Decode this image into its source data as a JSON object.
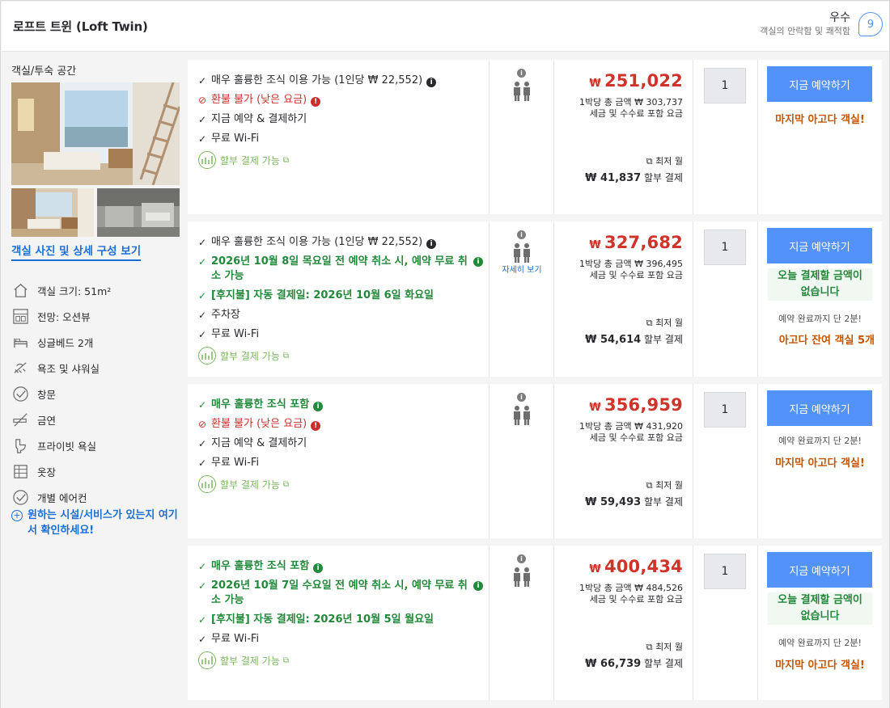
{
  "header": {
    "room_title": "로프트 트윈 (Loft Twin)",
    "score_label": "우수",
    "score_sub": "객실의 안락함 및 쾌적함",
    "score_value": "9"
  },
  "sidebar": {
    "section_title": "객실/투숙 공간",
    "photo_link": "객실 사진 및 상세 구성 보기",
    "facilities": [
      {
        "icon": "house-icon",
        "label": "객실 크기: 51m²"
      },
      {
        "icon": "window-view-icon",
        "label": "전망: 오션뷰"
      },
      {
        "icon": "bed-icon",
        "label": "싱글베드 2개"
      },
      {
        "icon": "shower-icon",
        "label": "욕조 및 샤워실"
      },
      {
        "icon": "check-circle-icon",
        "label": "창문"
      },
      {
        "icon": "no-smoking-icon",
        "label": "금연"
      },
      {
        "icon": "toilet-icon",
        "label": "프라이빗 욕실"
      },
      {
        "icon": "closet-icon",
        "label": "옷장"
      },
      {
        "icon": "check-circle-icon",
        "label": "개별 에어컨"
      }
    ],
    "more_link": "원하는 시설/서비스가 있는지 여기서 확인하세요!"
  },
  "common": {
    "installment_label": "할부 결제 가능",
    "book_button": "지금 예약하기",
    "qty": "1",
    "price_per_night": "1박당 총 금액",
    "tax_included": "세금 및 수수료 포함 요금",
    "min_month": "최저 월",
    "installment_pay": "할부 결제",
    "currency": "₩",
    "occupancy_detail": "자세히 보기"
  },
  "offers": [
    {
      "benefits": [
        {
          "type": "dark",
          "mark": "✓",
          "text": "매우 훌륭한 조식 이용 가능 (1인당 ₩ 22,552)",
          "info": "k"
        },
        {
          "type": "red",
          "mark": "⊘",
          "text": "환불 불가 (낮은 요금)",
          "info": "r"
        },
        {
          "type": "dark",
          "mark": "✓",
          "text": "지금 예약 & 결제하기"
        },
        {
          "type": "dark",
          "mark": "✓",
          "text": "무료 Wi-Fi"
        }
      ],
      "price": "251,022",
      "price_total": "₩ 303,737",
      "installment_amount": "41,837",
      "show_detail": false,
      "pay_none": null,
      "quick": null,
      "stock": null,
      "last_room": "마지막 아고다 객실!"
    },
    {
      "benefits": [
        {
          "type": "dark",
          "mark": "✓",
          "text": "매우 훌륭한 조식 이용 가능 (1인당 ₩ 22,552)",
          "info": "k"
        },
        {
          "type": "green",
          "mark": "✓",
          "text": "2026년 10월 8일 목요일 전 예약 취소 시, 예약 무료 취소 가능",
          "info_right": "g"
        },
        {
          "type": "green",
          "mark": "✓",
          "text": "[후지불] 자동 결제일: 2026년 10월 6일 화요일"
        },
        {
          "type": "dark",
          "mark": "✓",
          "text": "주차장"
        },
        {
          "type": "dark",
          "mark": "✓",
          "text": "무료 Wi-Fi"
        }
      ],
      "price": "327,682",
      "price_total": "₩ 396,495",
      "installment_amount": "54,614",
      "show_detail": true,
      "pay_none": "오늘 결제할 금액이 없습니다",
      "quick": "예약 완료까지 단 2분!",
      "stock": "아고다 잔여 객실 5개",
      "last_room": null
    },
    {
      "benefits": [
        {
          "type": "green",
          "mark": "✓",
          "text": "매우 훌륭한 조식 포함",
          "info": "g"
        },
        {
          "type": "red",
          "mark": "⊘",
          "text": "환불 불가 (낮은 요금)",
          "info": "r"
        },
        {
          "type": "dark",
          "mark": "✓",
          "text": "지금 예약 & 결제하기"
        },
        {
          "type": "dark",
          "mark": "✓",
          "text": "무료 Wi-Fi"
        }
      ],
      "price": "356,959",
      "price_total": "₩ 431,920",
      "installment_amount": "59,493",
      "show_detail": false,
      "pay_none": null,
      "quick": "예약 완료까지 단 2분!",
      "stock": null,
      "last_room": "마지막 아고다 객실!"
    },
    {
      "benefits": [
        {
          "type": "green",
          "mark": "✓",
          "text": "매우 훌륭한 조식 포함",
          "info": "g"
        },
        {
          "type": "green",
          "mark": "✓",
          "text": "2026년 10월 7일 수요일 전 예약 취소 시, 예약 무료 취소 가능",
          "info_right": "g"
        },
        {
          "type": "green",
          "mark": "✓",
          "text": "[후지불] 자동 결제일: 2026년 10월 5일 월요일"
        },
        {
          "type": "dark",
          "mark": "✓",
          "text": "무료 Wi-Fi"
        }
      ],
      "price": "400,434",
      "price_total": "₩ 484,526",
      "installment_amount": "66,739",
      "show_detail": false,
      "pay_none": "오늘 결제할 금액이 없습니다",
      "quick": "예약 완료까지 단 2분!",
      "stock": null,
      "last_room": "마지막 아고다 객실!"
    }
  ]
}
